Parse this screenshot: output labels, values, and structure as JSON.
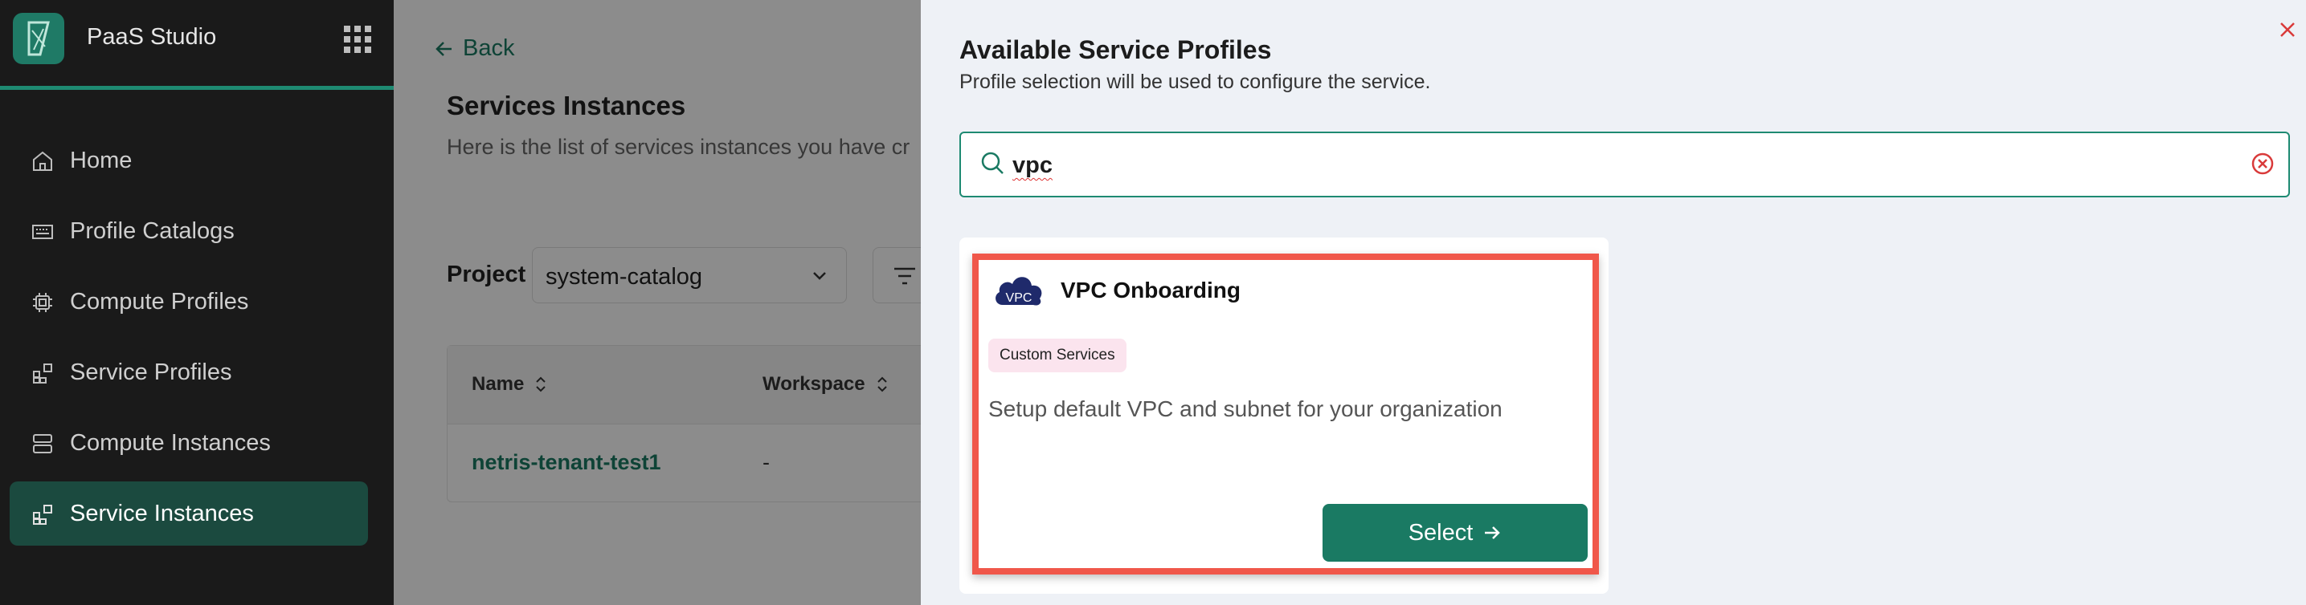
{
  "app": {
    "name": "PaaS Studio"
  },
  "sidebar": {
    "items": [
      {
        "label": "Home",
        "icon": "home-icon"
      },
      {
        "label": "Profile Catalogs",
        "icon": "catalog-icon"
      },
      {
        "label": "Compute Profiles",
        "icon": "cpu-icon"
      },
      {
        "label": "Service Profiles",
        "icon": "blocks-icon"
      },
      {
        "label": "Compute Instances",
        "icon": "server-icon"
      },
      {
        "label": "Service Instances",
        "icon": "blocks-icon",
        "active": true
      }
    ]
  },
  "main": {
    "back_label": "Back",
    "title": "Services Instances",
    "subtitle": "Here is the list of services instances you have cr",
    "project_label": "Project",
    "project_value": "system-catalog",
    "table": {
      "columns": [
        "Name",
        "Workspace"
      ],
      "rows": [
        {
          "name": "netris-tenant-test1",
          "workspace": "-"
        }
      ]
    }
  },
  "drawer": {
    "title": "Available Service Profiles",
    "subtitle": "Profile selection will be used to configure the service.",
    "search_value": "vpc",
    "card": {
      "icon_text": "VPC",
      "title": "VPC Onboarding",
      "badge": "Custom Services",
      "description": "Setup default VPC and subnet for your organization",
      "button_label": "Select"
    }
  },
  "colors": {
    "accent": "#1a7a63",
    "sidebar_bg": "#1a1a1a",
    "highlight_border": "#f0574a",
    "badge_bg": "#fbe4ee",
    "close_red": "#d93a3a"
  }
}
